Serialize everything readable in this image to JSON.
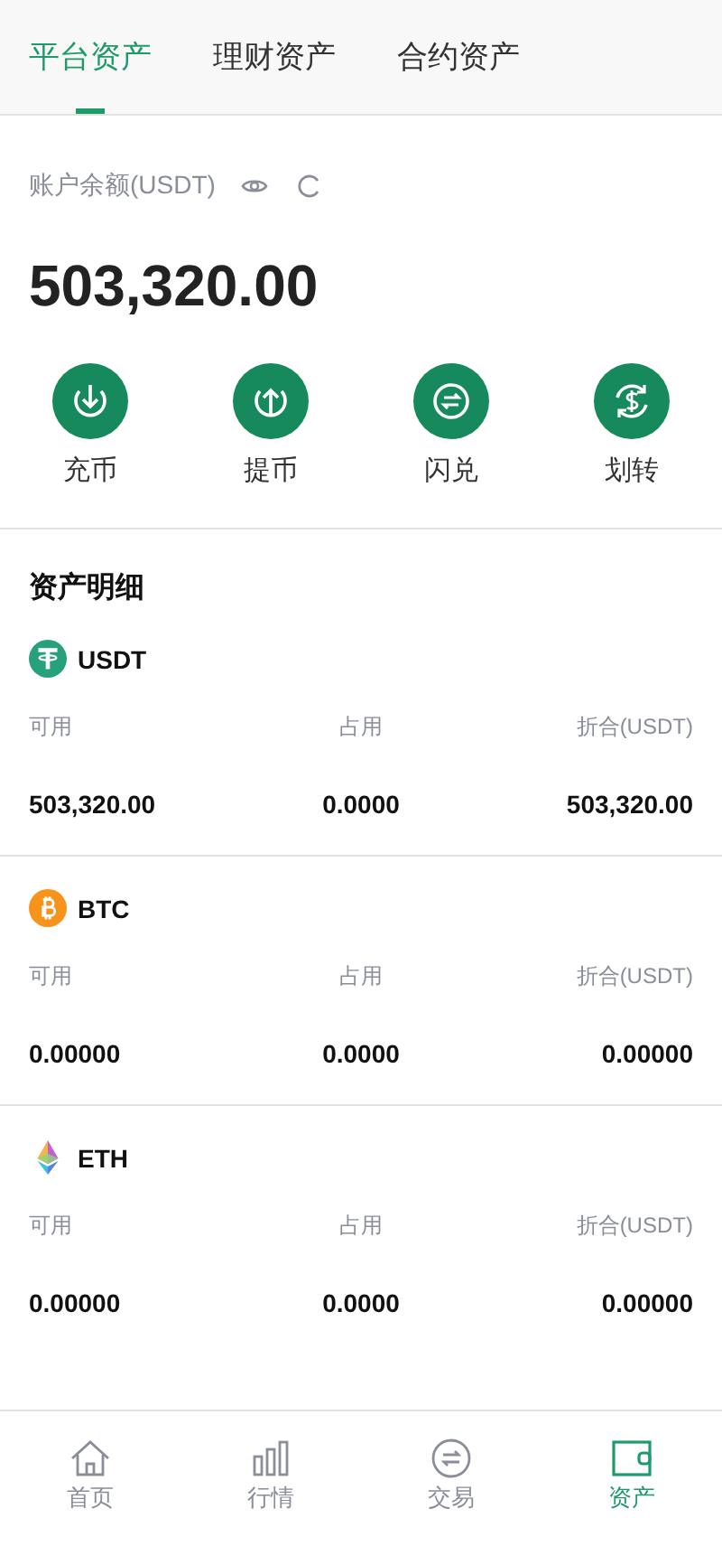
{
  "tabs": [
    {
      "label": "平台资产",
      "selected": true
    },
    {
      "label": "理财资产",
      "selected": false
    },
    {
      "label": "合约资产",
      "selected": false
    }
  ],
  "balance": {
    "label": "账户余额(USDT)",
    "amount": "503,320.00"
  },
  "actions": [
    {
      "kind": "deposit",
      "label": "充币"
    },
    {
      "kind": "withdraw",
      "label": "提币"
    },
    {
      "kind": "swap",
      "label": "闪兑"
    },
    {
      "kind": "transfer",
      "label": "划转"
    }
  ],
  "assets_title": "资产明细",
  "assets": [
    {
      "kind": "usdt",
      "name": "USDT",
      "available_label": "可用",
      "frozen_label": "占用",
      "value_label": "折合(USDT)",
      "available": "503,320.00",
      "frozen": "0.0000",
      "value": "503,320.00"
    },
    {
      "kind": "btc",
      "name": "BTC",
      "available_label": "可用",
      "frozen_label": "占用",
      "value_label": "折合(USDT)",
      "available": "0.00000",
      "frozen": "0.0000",
      "value": "0.00000"
    },
    {
      "kind": "eth",
      "name": "ETH",
      "available_label": "可用",
      "frozen_label": "占用",
      "value_label": "折合(USDT)",
      "available": "0.00000",
      "frozen": "0.0000",
      "value": "0.00000"
    }
  ],
  "nav": [
    {
      "kind": "home",
      "label": "首页",
      "selected": false
    },
    {
      "kind": "market",
      "label": "行情",
      "selected": false
    },
    {
      "kind": "trade",
      "label": "交易",
      "selected": false
    },
    {
      "kind": "assets",
      "label": "资产",
      "selected": true
    }
  ]
}
